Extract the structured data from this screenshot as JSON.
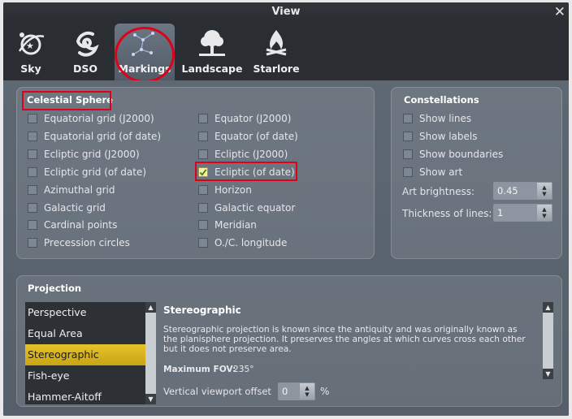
{
  "window": {
    "title": "View",
    "close_glyph": "✕"
  },
  "tabs": [
    {
      "label": "Sky",
      "icon": "sky-icon"
    },
    {
      "label": "DSO",
      "icon": "galaxy-icon"
    },
    {
      "label": "Markings",
      "icon": "constellation-icon",
      "selected": true
    },
    {
      "label": "Landscape",
      "icon": "tree-icon"
    },
    {
      "label": "Starlore",
      "icon": "campfire-icon"
    }
  ],
  "celestial": {
    "title": "Celestial Sphere",
    "left": [
      {
        "label": "Equatorial grid (J2000)",
        "checked": false
      },
      {
        "label": "Equatorial grid (of date)",
        "checked": false
      },
      {
        "label": "Ecliptic grid (J2000)",
        "checked": false
      },
      {
        "label": "Ecliptic grid (of date)",
        "checked": false
      },
      {
        "label": "Azimuthal grid",
        "checked": false
      },
      {
        "label": "Galactic grid",
        "checked": false
      },
      {
        "label": "Cardinal points",
        "checked": false
      },
      {
        "label": "Precession circles",
        "checked": false
      }
    ],
    "right": [
      {
        "label": "Equator (J2000)",
        "checked": false
      },
      {
        "label": "Equator (of date)",
        "checked": false
      },
      {
        "label": "Ecliptic (J2000)",
        "checked": false
      },
      {
        "label": "Ecliptic (of date)",
        "checked": true
      },
      {
        "label": "Horizon",
        "checked": false
      },
      {
        "label": "Galactic equator",
        "checked": false
      },
      {
        "label": "Meridian",
        "checked": false
      },
      {
        "label": "O./C. longitude",
        "checked": false
      }
    ]
  },
  "constellations": {
    "title": "Constellations",
    "items": [
      {
        "label": "Show lines",
        "checked": false
      },
      {
        "label": "Show labels",
        "checked": false
      },
      {
        "label": "Show boundaries",
        "checked": false
      },
      {
        "label": "Show art",
        "checked": false
      }
    ],
    "art_brightness_label": "Art brightness:",
    "art_brightness_value": "0.45",
    "thickness_label": "Thickness of lines:",
    "thickness_value": "1"
  },
  "projection": {
    "title": "Projection",
    "list": [
      "Perspective",
      "Equal Area",
      "Stereographic",
      "Fish-eye",
      "Hammer-Aitoff"
    ],
    "selected": "Stereographic",
    "heading": "Stereographic",
    "description_lines": [
      "Stereographic projection is known since the antiquity and was originally known as",
      "the planisphere projection. It preserves the angles at which curves cross each other",
      "but it does not preserve area."
    ],
    "max_fov_label": "Maximum FOV:",
    "max_fov_value": "235°",
    "viewport_offset_label": "Vertical viewport offset",
    "viewport_offset_value": "0",
    "viewport_offset_unit": "%"
  },
  "colors": {
    "highlight": "#e00018",
    "selection": "#d6b11c",
    "checked_box": "#f5f0a6"
  }
}
